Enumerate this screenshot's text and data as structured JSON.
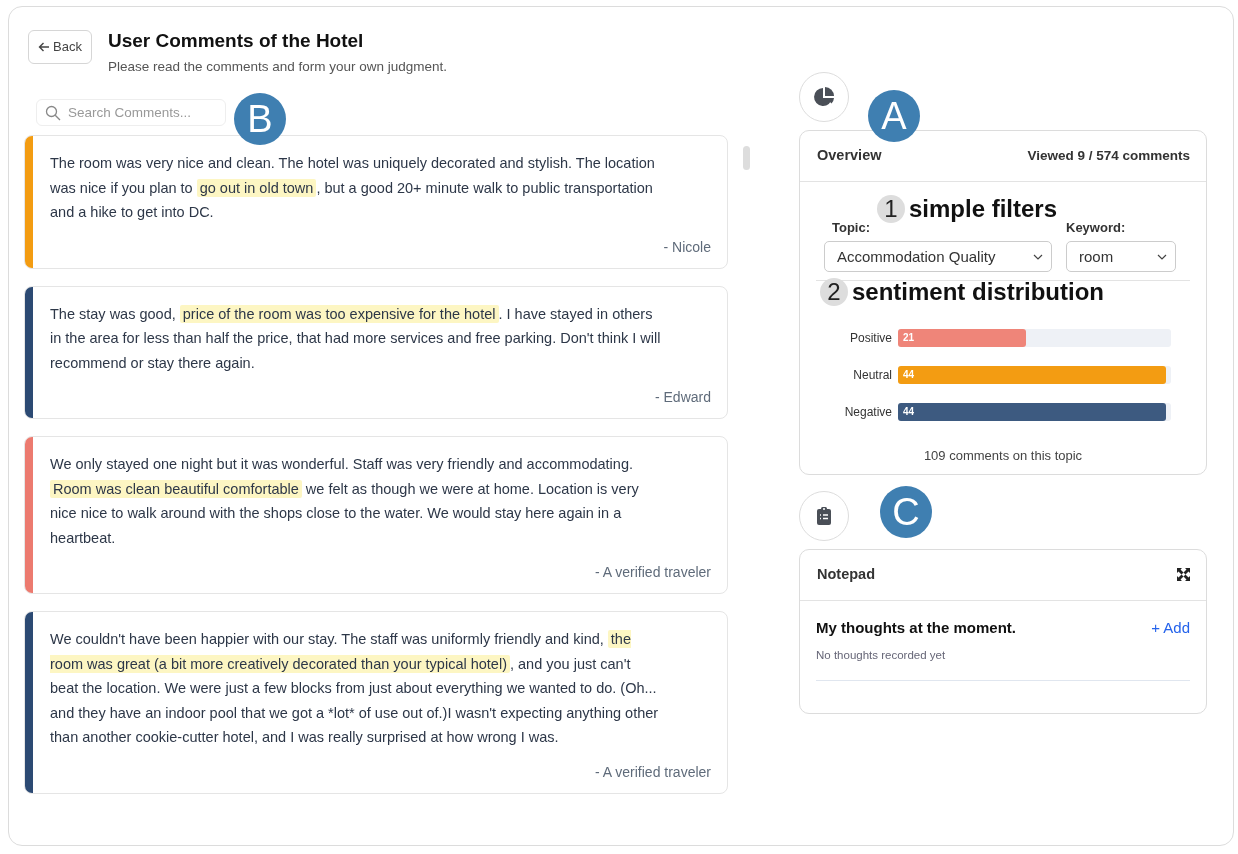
{
  "header": {
    "back_button": "Back",
    "title": "User Comments of the Hotel",
    "subtitle": "Please read the comments and form your own judgment."
  },
  "search": {
    "placeholder": "Search Comments..."
  },
  "comments": [
    {
      "color": "#f39c12",
      "before": "The room was very nice and clean. The hotel was uniquely decorated and stylish. The location was nice if you plan to ",
      "highlight": "go out in old town",
      "after": ", but a good 20+ minute walk to public transportation and a hike to get into DC.",
      "author": "- Nicole"
    },
    {
      "color": "#2c4a73",
      "before": "The stay was good, ",
      "highlight": "price of the room was too expensive for the hotel",
      "after": ". I have stayed in others in the area for less than half the price, that had more services and free parking. Don't think I will recommend or stay there again.",
      "author": "- Edward"
    },
    {
      "color": "#ec7a6f",
      "before": "We only stayed one night but it was wonderful. Staff was very friendly and accommodating. ",
      "highlight": "Room was clean beautiful comfortable",
      "after": " we felt as though we were at home. Location is very nice nice to walk around with the shops close to the water. We would stay here again in a heartbeat.",
      "author": "- A verified traveler"
    },
    {
      "color": "#2c4a73",
      "before": "We couldn't have been happier with our stay. The staff was uniformly friendly and kind, ",
      "highlight": "the room was great (a bit more creatively decorated than your typical hotel)",
      "after": ", and you just can't beat the location. We were just a few blocks from just about everything we wanted to do. (Oh... and they have an indoor pool that we got a *lot* of use out of.)I wasn't expecting anything other than another cookie-cutter hotel, and I was really surprised at how wrong I was.",
      "author": "- A verified traveler"
    }
  ],
  "overview": {
    "title": "Overview",
    "viewed": "Viewed 9 / 574 comments",
    "topic_label": "Topic:",
    "topic_value": "Accommodation Quality",
    "keyword_label": "Keyword:",
    "keyword_value": "room",
    "sentiments": [
      {
        "label": "Positive",
        "count": "21",
        "level": 0.47,
        "color": "#ef8579"
      },
      {
        "label": "Neutral",
        "count": "44",
        "level": 0.98,
        "color": "#f39c12"
      },
      {
        "label": "Negative",
        "count": "44",
        "level": 0.98,
        "color": "#3d5a80"
      }
    ],
    "footer": "109 comments on this topic"
  },
  "notepad": {
    "title": "Notepad",
    "heading": "My thoughts at the moment.",
    "add_button": "+ Add",
    "empty": "No thoughts recorded yet"
  },
  "annotations": {
    "a": "A",
    "b": "B",
    "c": "C",
    "filters_number": "1",
    "filters_label": "simple filters",
    "distribution_number": "2",
    "distribution_label": "sentiment distribution"
  }
}
